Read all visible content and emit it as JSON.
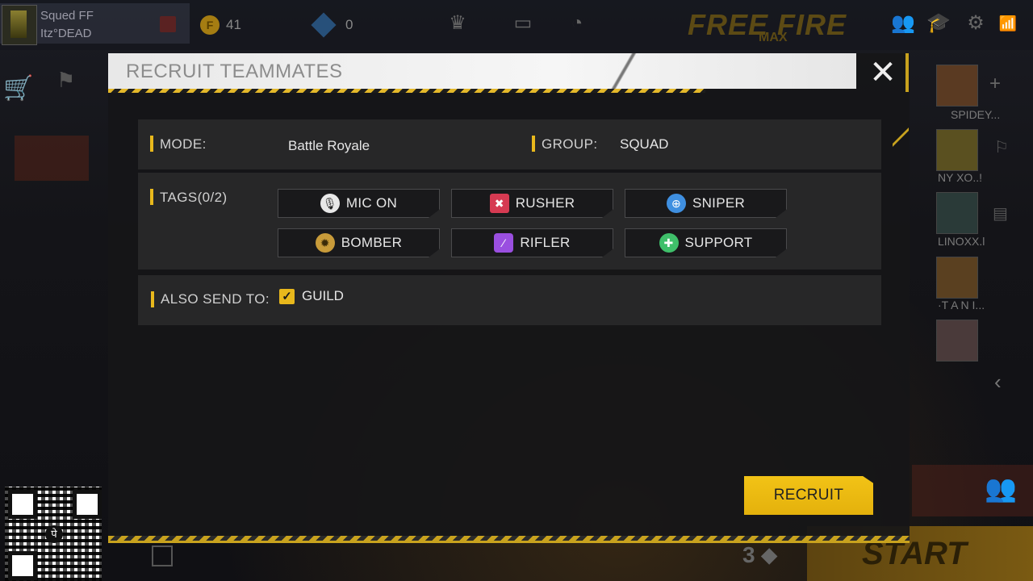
{
  "background": {
    "player": {
      "name_top": "Squed   FF",
      "name_bottom": "Itz°DEAD"
    },
    "currency": {
      "coins": "41",
      "diamonds": "0"
    },
    "logo": {
      "line1": "FREE FIRE",
      "line2": "MAX"
    },
    "friends": [
      {
        "name": "SPIDEY..."
      },
      {
        "name": "NY   XO..!"
      },
      {
        "name": "LINOXX.l"
      },
      {
        "name": "·T A N I..."
      },
      {
        "name": ""
      }
    ],
    "start_label": "START",
    "rank_label": "3"
  },
  "modal": {
    "title": "RECRUIT TEAMMATES",
    "close_icon": "close-icon",
    "mode_label": "MODE:",
    "mode_value": "Battle Royale",
    "group_label": "GROUP:",
    "group_value": "SQUAD",
    "tags_label": "TAGS(0/2)",
    "tags": [
      {
        "label": "MIC ON",
        "icon": "microphone-icon",
        "color": "#d8d8d8"
      },
      {
        "label": "RUSHER",
        "icon": "rusher-icon",
        "color": "#e0445a"
      },
      {
        "label": "SNIPER",
        "icon": "crosshair-icon",
        "color": "#3f8fe0"
      },
      {
        "label": "BOMBER",
        "icon": "bomber-icon",
        "color": "#c89b3a"
      },
      {
        "label": "RIFLER",
        "icon": "rifle-icon",
        "color": "#9a4fe0"
      },
      {
        "label": "SUPPORT",
        "icon": "support-icon",
        "color": "#3fbf6a"
      }
    ],
    "also_send_label": "ALSO SEND TO:",
    "guild_label": "GUILD",
    "guild_checked": true,
    "recruit_label": "RECRUIT"
  },
  "colors": {
    "accent": "#e8b81c"
  }
}
